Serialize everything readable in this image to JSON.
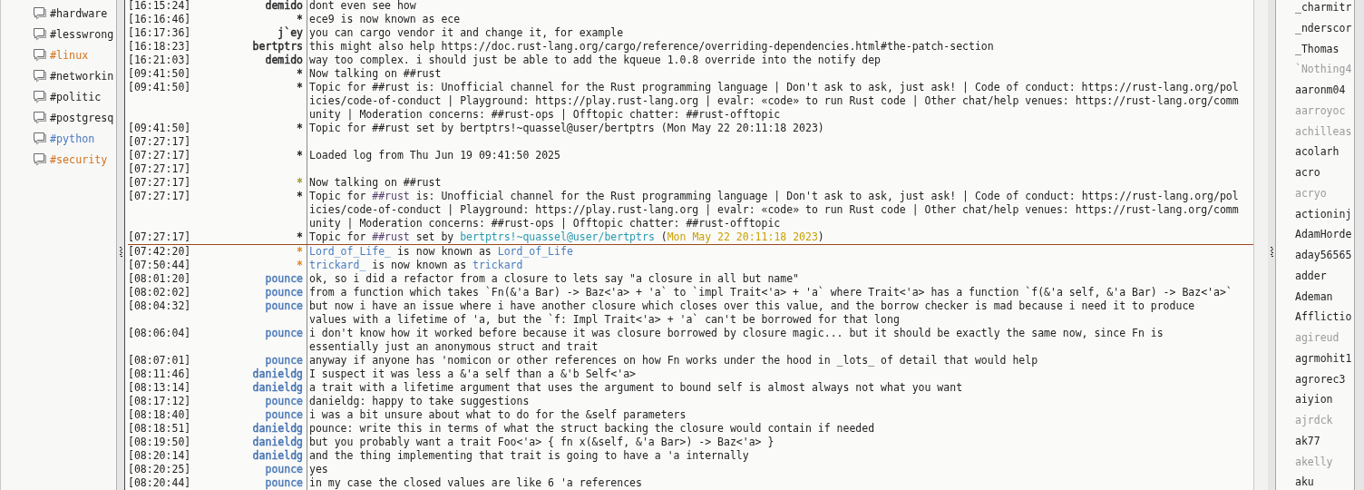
{
  "sidebar": {
    "channels": [
      {
        "name": "#hardware",
        "color": "#222222"
      },
      {
        "name": "#lesswrong",
        "color": "#222222"
      },
      {
        "name": "#linux",
        "color": "#d4731e"
      },
      {
        "name": "#networkin",
        "color": "#222222"
      },
      {
        "name": "#politic",
        "color": "#222222"
      },
      {
        "name": "#postgresq",
        "color": "#222222"
      },
      {
        "name": "#python",
        "color": "#4a78c0"
      },
      {
        "name": "#security",
        "color": "#d4731e"
      }
    ]
  },
  "chat": {
    "rows": [
      {
        "kind": "message",
        "time": "[16:15:24]",
        "sender": "demido",
        "color": "#222222",
        "text": "dont even see how"
      },
      {
        "kind": "message",
        "time": "[16:16:46]",
        "sender": "*",
        "text": "ece9 is now known as ece"
      },
      {
        "kind": "message",
        "time": "[16:17:36]",
        "sender": "j`ey",
        "color": "#222222",
        "text": "you can cargo vendor it and change it, for example"
      },
      {
        "kind": "message",
        "time": "[16:18:23]",
        "sender": "bertptrs",
        "color": "#222222",
        "text": "this might also help https://doc.rust-lang.org/cargo/reference/overriding-dependencies.html#the-patch-section"
      },
      {
        "kind": "message",
        "time": "[16:21:03]",
        "sender": "demido",
        "color": "#222222",
        "text": "way too complex. i should just be able to add the kqueue 1.0.8 override into the notify dep"
      },
      {
        "kind": "message",
        "time": "[09:41:50]",
        "sender": "*",
        "text": "Now talking on ##rust"
      },
      {
        "kind": "message",
        "time": "[09:41:50]",
        "sender": "*",
        "segments": [
          {
            "kind": "plain",
            "text": "Topic for ##rust is: Unofficial channel for the Rust programming language | Don't ask to ask, just ask! | Code of conduct: "
          },
          {
            "kind": "url",
            "text": "https://rust-lang.org/policies/code-of-conduct"
          },
          {
            "kind": "plain",
            "text": " | Playground: "
          },
          {
            "kind": "url",
            "text": "https://play.rust-lang.org"
          },
          {
            "kind": "plain",
            "text": " | evalr: «code» to run Rust code | Other chat/help venues: "
          },
          {
            "kind": "url",
            "text": "https://rust-lang.org/community"
          },
          {
            "kind": "plain",
            "text": " | Moderation concerns: ##rust-ops | Offtopic chatter: ##rust-offtopic"
          }
        ]
      },
      {
        "kind": "message",
        "time": "[09:41:50]",
        "sender": "*",
        "text": "Topic for ##rust set by bertptrs!~quassel@user/bertptrs (Mon May 22 20:11:18 2023)"
      },
      {
        "kind": "message",
        "time": "[07:27:17]"
      },
      {
        "kind": "message",
        "time": "[07:27:17]",
        "sender": "*",
        "text": "Loaded log from Thu Jun 19 09:41:50 2025"
      },
      {
        "kind": "message",
        "time": "[07:27:17]"
      },
      {
        "kind": "message",
        "time": "[07:27:17]",
        "sender": "*",
        "color": "#9a9a2c",
        "text": "Now talking on ##rust"
      },
      {
        "kind": "message",
        "time": "[07:27:17]",
        "sender": "*",
        "segments": [
          {
            "kind": "plain",
            "text": "Topic for "
          },
          {
            "kind": "channel",
            "text": "##rust"
          },
          {
            "kind": "plain",
            "text": " is: Unofficial channel for the Rust programming language | Don't ask to ask, just ask! | Code of conduct: "
          },
          {
            "kind": "url",
            "text": "https://rust-lang.org/policies/code-of-conduct"
          },
          {
            "kind": "plain",
            "text": " | Playground: "
          },
          {
            "kind": "url",
            "text": "https://play.rust-lang.org"
          },
          {
            "kind": "plain",
            "text": " | evalr: «code» to run Rust code | Other chat/help venues: "
          },
          {
            "kind": "url",
            "text": "https://rust-lang.org/community"
          },
          {
            "kind": "plain",
            "text": " | Moderation concerns: ##rust-ops | Offtopic chatter: ##rust-offtopic"
          }
        ]
      },
      {
        "kind": "message",
        "time": "[07:27:17]",
        "sender": "*",
        "segments": [
          {
            "kind": "plain",
            "text": "Topic for "
          },
          {
            "kind": "channel",
            "text": "##rust"
          },
          {
            "kind": "plain",
            "text": " set by "
          },
          {
            "kind": "host",
            "text": "bertptrs!~quassel@user/bertptrs"
          },
          {
            "kind": "plain",
            "text": " ("
          },
          {
            "kind": "date",
            "text": "Mon May 22 20:11:18 2023"
          },
          {
            "kind": "plain",
            "text": ")"
          }
        ]
      },
      {
        "kind": "marker"
      },
      {
        "kind": "message",
        "time": "[07:42:20]",
        "sender": "*",
        "color": "#e0891e",
        "segments": [
          {
            "kind": "nick",
            "text": "Lord_of_Life_"
          },
          {
            "kind": "plain",
            "text": " is now known as "
          },
          {
            "kind": "nick",
            "text": "Lord_of_Life"
          }
        ]
      },
      {
        "kind": "message",
        "time": "[07:50:44]",
        "sender": "*",
        "color": "#e0891e",
        "segments": [
          {
            "kind": "nick",
            "text": "trickard_"
          },
          {
            "kind": "plain",
            "text": " is now known as "
          },
          {
            "kind": "nick",
            "text": "trickard"
          }
        ]
      },
      {
        "kind": "message",
        "time": "[08:01:20]",
        "sender": "pounce",
        "color": "#4a78b8",
        "text": "ok, so i did a refactor from a closure to lets say \"a closure in all but name\""
      },
      {
        "kind": "message",
        "time": "[08:02:02]",
        "sender": "pounce",
        "color": "#4a78b8",
        "text": "from a function which takes `Fn(&'a Bar) -> Baz<'a> + 'a` to `impl Trait<'a> + 'a` where Trait<'a> has a function `f(&'a self, &'a Bar) -> Baz<'a>`"
      },
      {
        "kind": "message",
        "time": "[08:04:32]",
        "sender": "pounce",
        "color": "#4a78b8",
        "text": "but now i have an issue where i have another closure which closes over this value, and the borrow checker is mad because i need it to produce values with a lifetime of 'a, but the `f: Impl Trait<'a> + 'a` can't be borrowed for that long"
      },
      {
        "kind": "message",
        "time": "[08:06:04]",
        "sender": "pounce",
        "color": "#4a78b8",
        "text": "i don't know how it worked before because it was closure borrowed by closure magic... but it should be exactly the same now, since Fn is essentially just an anonymous struct and trait"
      },
      {
        "kind": "message",
        "time": "[08:07:01]",
        "sender": "pounce",
        "color": "#4a78b8",
        "text": "anyway if anyone has 'nomicon or other references on how Fn works under the hood in _lots_ of detail that would help"
      },
      {
        "kind": "message",
        "time": "[08:11:46]",
        "sender": "danieldg",
        "color": "#3f6fb0",
        "text": "I suspect it was less a &'a self than a &'b Self<'a>"
      },
      {
        "kind": "message",
        "time": "[08:13:14]",
        "sender": "danieldg",
        "color": "#3f6fb0",
        "text": "a trait with a lifetime argument that uses the argument to bound self is almost always not what you want"
      },
      {
        "kind": "message",
        "time": "[08:17:12]",
        "sender": "pounce",
        "color": "#4a78b8",
        "text": "danieldg: happy to take suggestions"
      },
      {
        "kind": "message",
        "time": "[08:18:40]",
        "sender": "pounce",
        "color": "#4a78b8",
        "text": "i was a bit unsure about what to do for the &self parameters"
      },
      {
        "kind": "message",
        "time": "[08:18:51]",
        "sender": "danieldg",
        "color": "#3f6fb0",
        "text": "pounce: write this in terms of what the struct backing the closure would contain if needed"
      },
      {
        "kind": "message",
        "time": "[08:19:50]",
        "sender": "danieldg",
        "color": "#3f6fb0",
        "text": "but you probably want a trait Foo<'a> { fn x(&self, &'a Bar>) -> Baz<'a> }"
      },
      {
        "kind": "message",
        "time": "[08:20:14]",
        "sender": "danieldg",
        "color": "#3f6fb0",
        "text": "and the thing implementing that trait is going to have a 'a internally"
      },
      {
        "kind": "message",
        "time": "[08:20:25]",
        "sender": "pounce",
        "color": "#4a78b8",
        "text": "yes"
      },
      {
        "kind": "message",
        "time": "[08:20:44]",
        "sender": "pounce",
        "color": "#4a78b8",
        "text": "in my case the closed values are like 6 'a references"
      }
    ]
  },
  "nick_list": [
    {
      "nick": "_charmitr",
      "away": false
    },
    {
      "nick": "_nderscor",
      "away": false
    },
    {
      "nick": "_Thomas",
      "away": false
    },
    {
      "nick": "`Nothing4",
      "away": true
    },
    {
      "nick": "aaronm04",
      "away": false
    },
    {
      "nick": "aarroyoc",
      "away": true
    },
    {
      "nick": "achilleas",
      "away": true
    },
    {
      "nick": "acolarh",
      "away": false
    },
    {
      "nick": "acro",
      "away": false
    },
    {
      "nick": "acryo",
      "away": true
    },
    {
      "nick": "actioninj",
      "away": false
    },
    {
      "nick": "AdamHorde",
      "away": false
    },
    {
      "nick": "aday56565",
      "away": false
    },
    {
      "nick": "adder",
      "away": false
    },
    {
      "nick": "Ademan",
      "away": false
    },
    {
      "nick": "Afflictio",
      "away": false
    },
    {
      "nick": "agireud",
      "away": true
    },
    {
      "nick": "agrmohit1",
      "away": false
    },
    {
      "nick": "agrorec3",
      "away": false
    },
    {
      "nick": "aiyion",
      "away": false
    },
    {
      "nick": "ajrdck",
      "away": true
    },
    {
      "nick": "ak77",
      "away": false
    },
    {
      "nick": "akelly",
      "away": true
    },
    {
      "nick": "aku",
      "away": false
    }
  ]
}
